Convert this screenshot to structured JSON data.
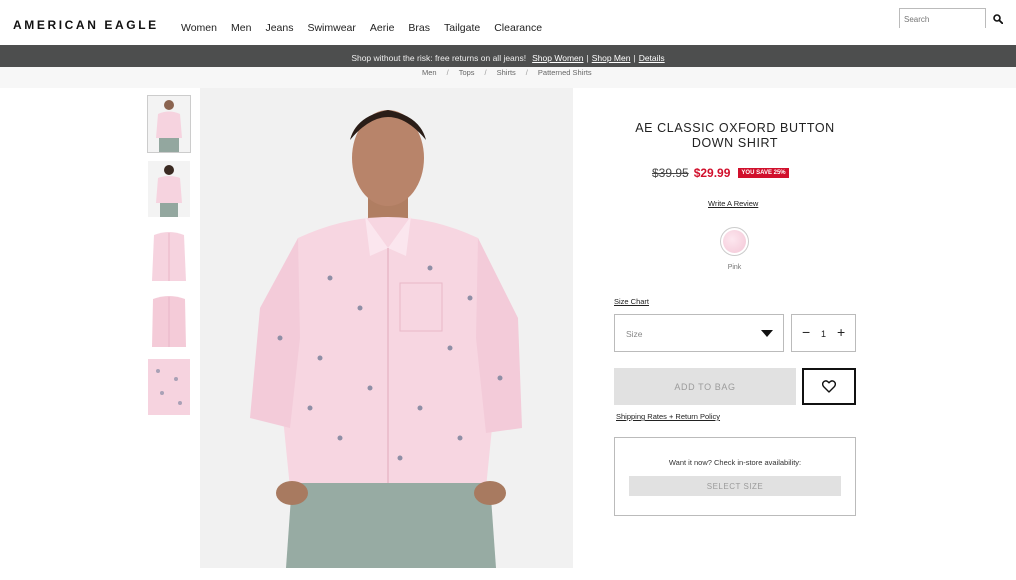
{
  "header": {
    "logo": "AMERICAN EAGLE",
    "nav": [
      "Women",
      "Men",
      "Jeans",
      "Swimwear",
      "Aerie",
      "Bras",
      "Tailgate",
      "Clearance"
    ],
    "search_placeholder": "Search"
  },
  "promo": {
    "message": "Shop without the risk: free returns on all jeans!",
    "links": [
      "Shop Women",
      "Shop Men",
      "Details"
    ],
    "separator": "|"
  },
  "breadcrumb": [
    "Men",
    "Tops",
    "Shirts",
    "Patterned Shirts"
  ],
  "product": {
    "title": "AE CLASSIC OXFORD BUTTON DOWN SHIRT",
    "old_price": "$39.95",
    "new_price": "$29.99",
    "save_badge": "YOU SAVE 25%",
    "write_review": "Write A Review",
    "color_label": "Pink",
    "size_chart": "Size Chart",
    "size_placeholder": "Size",
    "qty_minus": "−",
    "qty_value": "1",
    "qty_plus": "+",
    "add_to_bag": "ADD TO BAG",
    "shipping_link": "Shipping Rates + Return Policy",
    "instore_text": "Want it now? Check in-store availability:",
    "select_size": "SELECT SIZE"
  },
  "icons": {
    "search": "search-icon",
    "wishlist": "heart-icon",
    "dropdown": "chevron-down-icon"
  },
  "colors": {
    "sale_red": "#d1102c",
    "promo_bg": "#4d4e4e",
    "shirt_pink": "#f6d3df",
    "pants_sage": "#93a79f"
  }
}
